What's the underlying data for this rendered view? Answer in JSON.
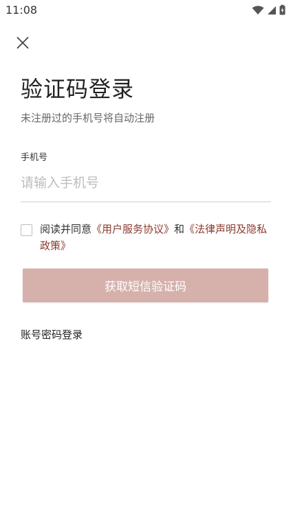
{
  "status_bar": {
    "time": "11:08"
  },
  "header": {
    "close_icon": "close-icon"
  },
  "title": "验证码登录",
  "subtitle": "未注册过的手机号将自动注册",
  "phone": {
    "label": "手机号",
    "placeholder": "请输入手机号",
    "value": ""
  },
  "agreement": {
    "prefix": "阅读并同意",
    "user_agreement": "《用户服务协议》",
    "connector": "和",
    "legal_privacy": "《法律声明及隐私政策》",
    "link_color": "#8a3a2e"
  },
  "get_code_button": {
    "label": "获取短信验证码",
    "color": "#d6b1ab"
  },
  "password_login": {
    "label": "账号密码登录"
  }
}
